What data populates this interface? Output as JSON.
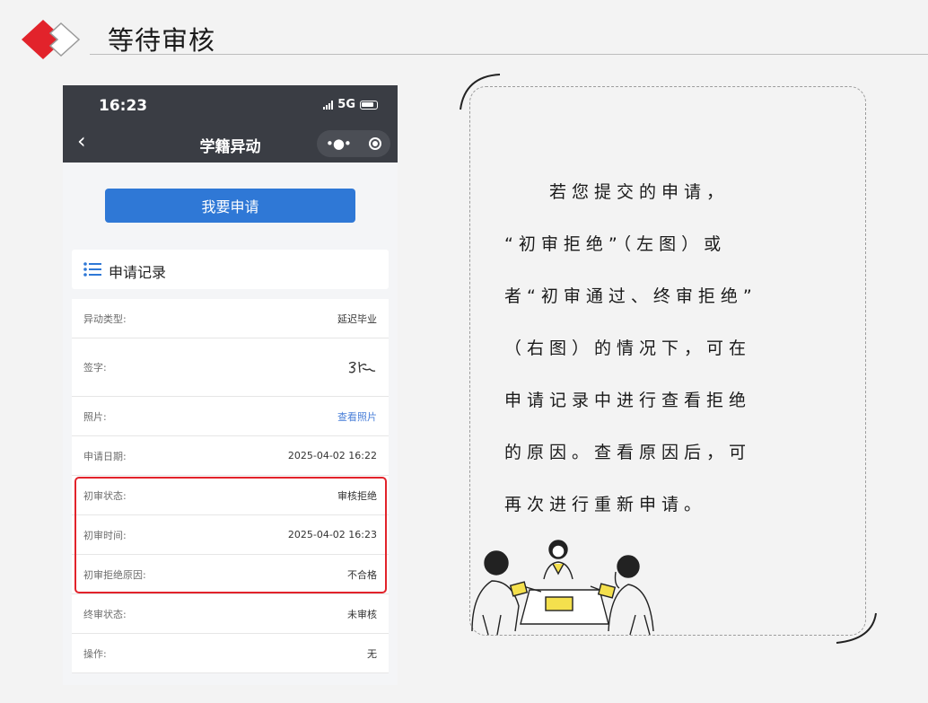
{
  "slide": {
    "title": "等待审核"
  },
  "phone": {
    "status": {
      "time": "16:23",
      "network": "5G"
    },
    "nav": {
      "back_icon": "chevron-left-icon",
      "title": "学籍异动",
      "more_icon": "more-icon",
      "close_icon": "target-icon"
    },
    "apply_button": "我要申请",
    "records": {
      "title": "申请记录",
      "rows": [
        {
          "label": "异动类型:",
          "value": "延迟毕业"
        },
        {
          "label": "签字:",
          "value": ""
        },
        {
          "label": "照片:",
          "value": "查看照片"
        },
        {
          "label": "申请日期:",
          "value": "2025-04-02 16:22"
        },
        {
          "label": "初审状态:",
          "value": "审核拒绝"
        },
        {
          "label": "初审时间:",
          "value": "2025-04-02 16:23"
        },
        {
          "label": "初审拒绝原因:",
          "value": "不合格"
        },
        {
          "label": "终审状态:",
          "value": "未审核"
        },
        {
          "label": "操作:",
          "value": "无"
        }
      ]
    },
    "colors": {
      "primary_button": "#2f78d6",
      "highlight_border": "#e2232b",
      "link": "#4a7fd8"
    }
  },
  "explanation": {
    "lines": [
      "　　若您提交的申请，",
      "“初审拒绝”（左图）或",
      "者“初审通过、终审拒绝”",
      "（右图）的情况下，可在",
      "申请记录中进行查看拒绝",
      "的原因。查看原因后，可",
      "再次进行重新申请。"
    ]
  },
  "colors": {
    "accent_red": "#e2232b"
  }
}
